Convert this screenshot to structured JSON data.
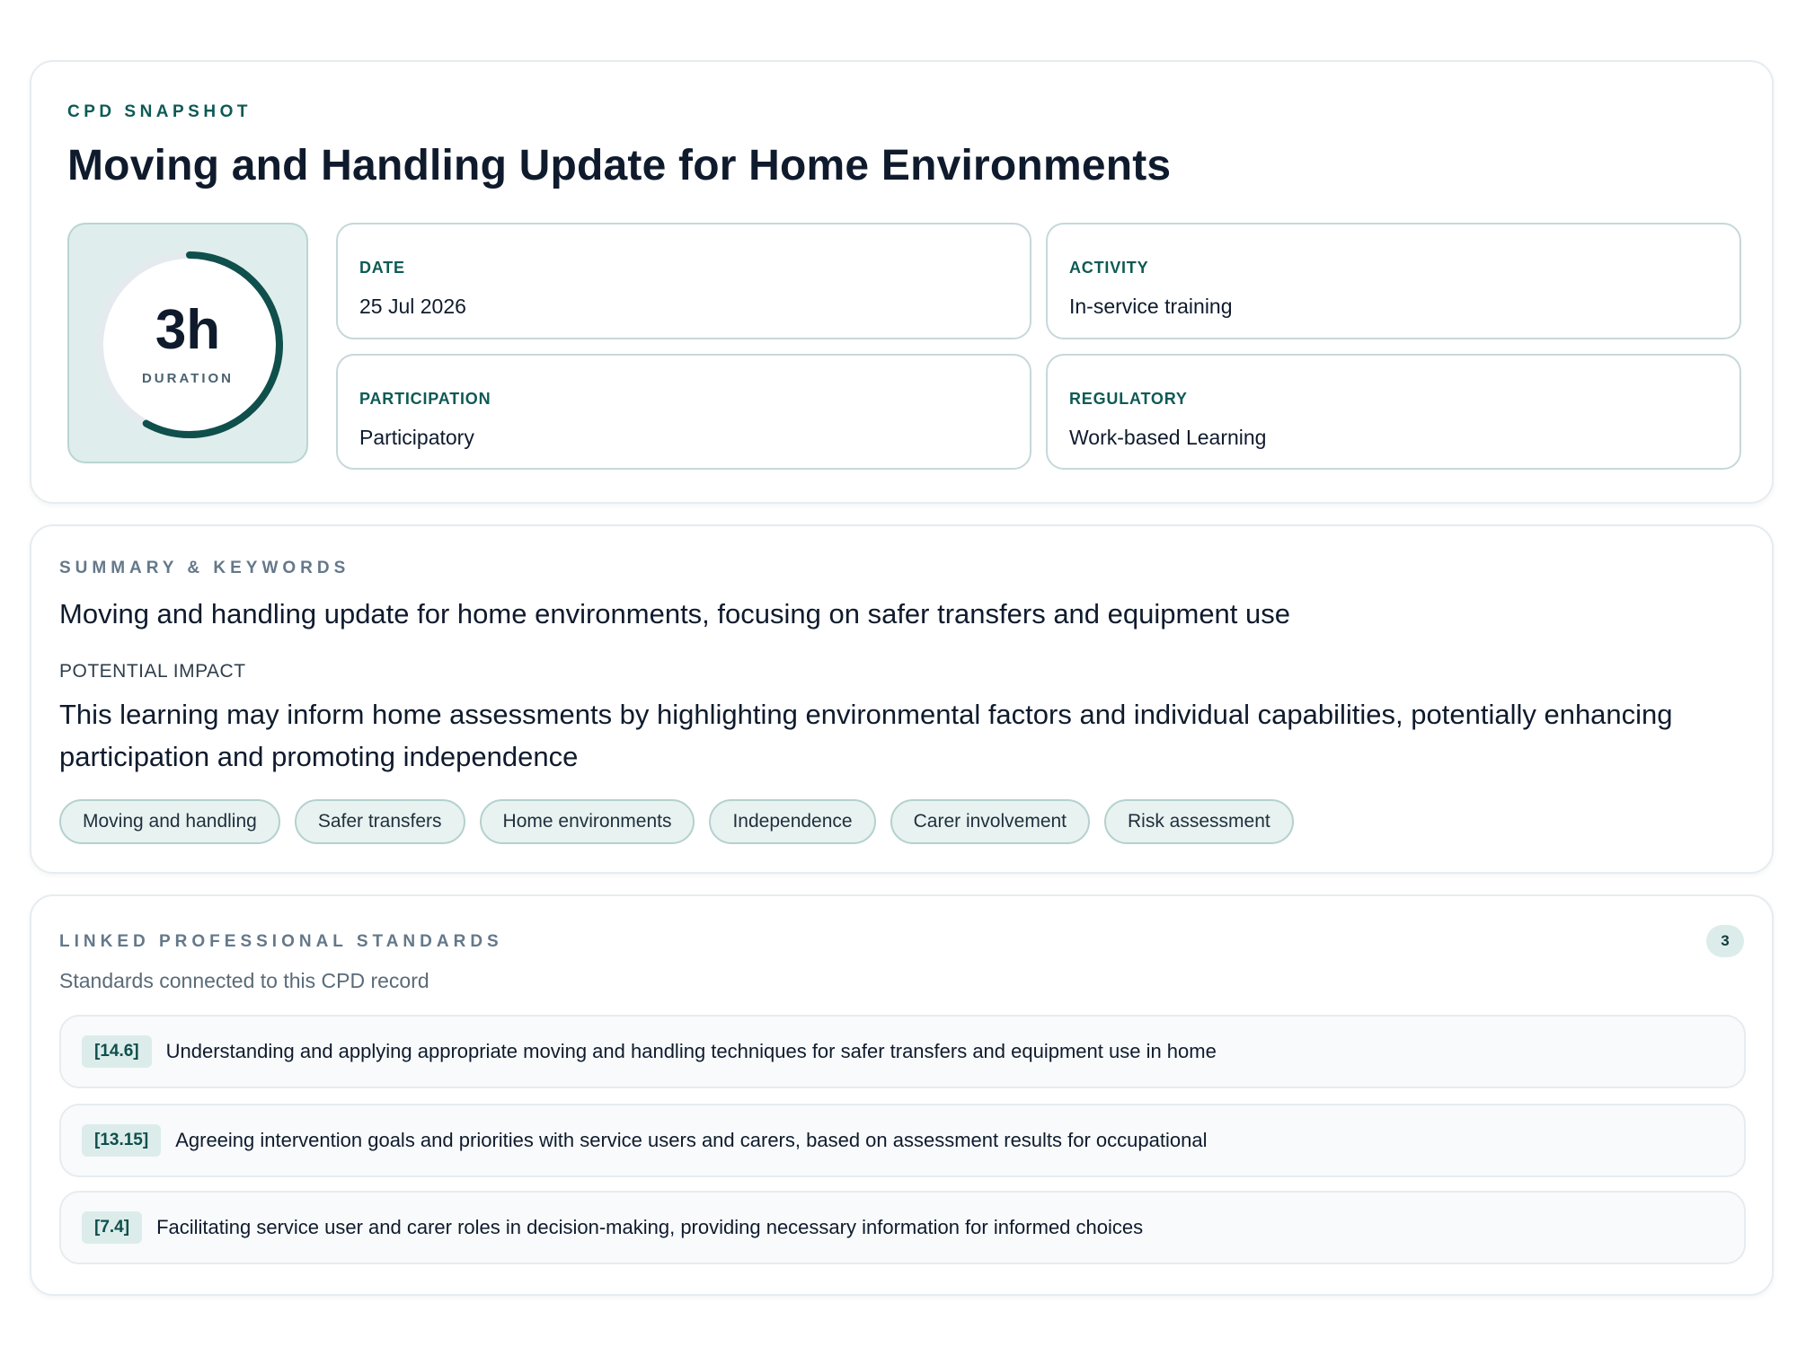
{
  "snapshot": {
    "eyebrow": "CPD SNAPSHOT",
    "title": "Moving and Handling Update for Home Environments",
    "duration": {
      "value": "3h",
      "label": "DURATION",
      "ring_fill_fraction": 0.58
    },
    "meta": {
      "date": {
        "label": "DATE",
        "value": "25 Jul 2026"
      },
      "activity": {
        "label": "ACTIVITY",
        "value": "In-service training"
      },
      "participation": {
        "label": "PARTICIPATION",
        "value": "Participatory"
      },
      "regulatory": {
        "label": "REGULATORY",
        "value": "Work-based Learning"
      }
    }
  },
  "summary": {
    "eyebrow": "SUMMARY & KEYWORDS",
    "text": "Moving and handling update for home environments, focusing on safer transfers and equipment use",
    "impact_label": "POTENTIAL IMPACT",
    "impact_text": "This learning may inform home assessments by highlighting environmental factors and individual capabilities, potentially enhancing participation and promoting independence",
    "keywords": [
      "Moving and handling",
      "Safer transfers",
      "Home environments",
      "Independence",
      "Carer involvement",
      "Risk assessment"
    ]
  },
  "standards": {
    "eyebrow": "LINKED PROFESSIONAL STANDARDS",
    "count": "3",
    "subtitle": "Standards connected to this CPD record",
    "items": [
      {
        "code": "[14.6]",
        "text": "Understanding and applying appropriate moving and handling techniques for safer transfers and equipment use in home"
      },
      {
        "code": "[13.15]",
        "text": "Agreeing intervention goals and priorities with service users and carers, based on assessment results for occupational"
      },
      {
        "code": "[7.4]",
        "text": "Facilitating service user and carer roles in decision-making, providing necessary information for informed choices"
      }
    ]
  },
  "colors": {
    "accent": "#0e5a55",
    "ring": "#0f4f4c",
    "tile_bg": "#dfeeec",
    "chip_bg": "#e8f2f1"
  }
}
